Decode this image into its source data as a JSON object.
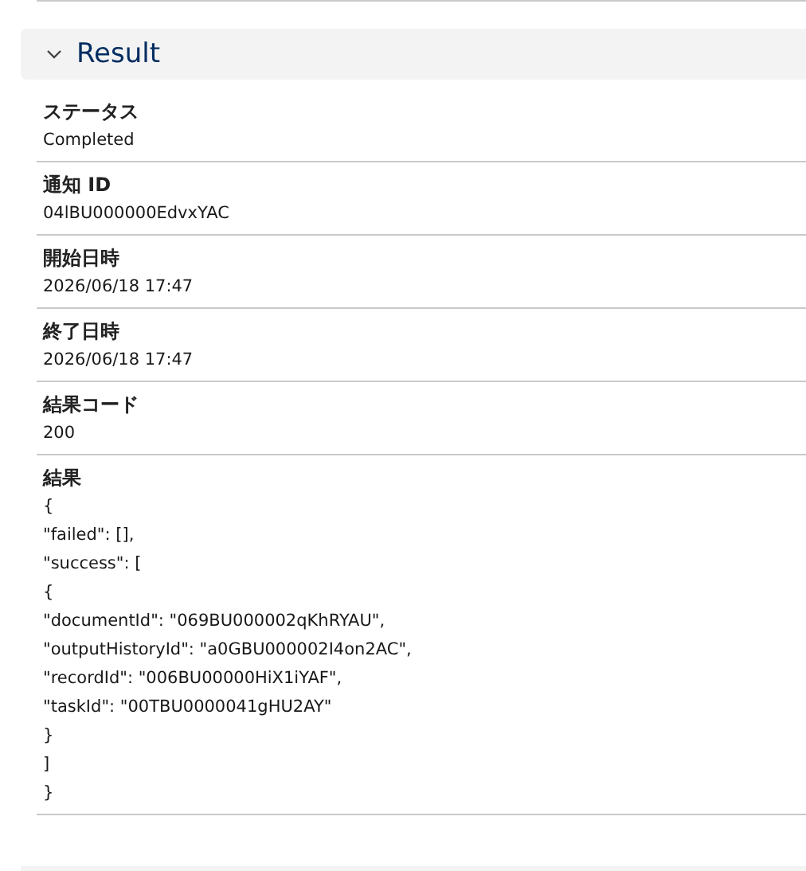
{
  "section": {
    "title": "Result",
    "expanded": true
  },
  "fields": [
    {
      "label": "ステータス",
      "lines": [
        "Completed"
      ]
    },
    {
      "label": "通知 ID",
      "lines": [
        "04lBU000000EdvxYAC"
      ]
    },
    {
      "label": "開始日時",
      "lines": [
        "2026/06/18 17:47"
      ]
    },
    {
      "label": "終了日時",
      "lines": [
        "2026/06/18 17:47"
      ]
    },
    {
      "label": "結果コード",
      "lines": [
        "200"
      ]
    },
    {
      "label": "結果",
      "lines": [
        "{",
        "\"failed\": [],",
        "\"success\": [",
        "{",
        "\"documentId\": \"069BU000002qKhRYAU\",",
        "\"outputHistoryId\": \"a0GBU000002I4on2AC\",",
        "\"recordId\": \"006BU00000HiX1iYAF\",",
        "\"taskId\": \"00TBU0000041gHU2AY\"",
        "}",
        "]",
        "}"
      ]
    }
  ]
}
